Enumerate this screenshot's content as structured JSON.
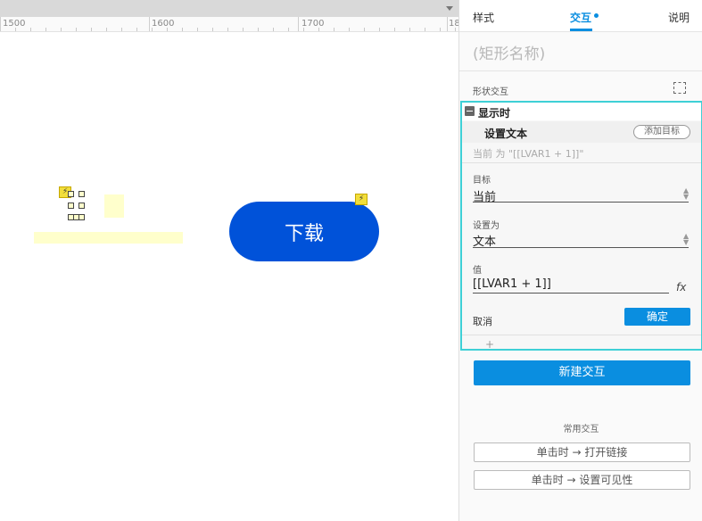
{
  "ruler": {
    "labels": [
      "1500",
      "1600",
      "1700",
      "18"
    ]
  },
  "canvas": {
    "download_label": "下载",
    "bolt_symbol": "⚡"
  },
  "panel": {
    "tabs": [
      {
        "label": "样式",
        "active": false
      },
      {
        "label": "交互",
        "active": true
      },
      {
        "label": "说明",
        "active": false
      }
    ],
    "shape_name_placeholder": "(矩形名称)",
    "section_title": "形状交互",
    "event_label": "显示时",
    "action_label": "设置文本",
    "add_target_label": "添加目标",
    "action_summary": "当前 为 \"[[LVAR1 + 1]]\"",
    "fields": {
      "target_label": "目标",
      "target_value": "当前",
      "set_as_label": "设置为",
      "set_as_value": "文本",
      "value_label": "值",
      "value_value": "[[LVAR1 + 1]]"
    },
    "fx_label": "fx",
    "cancel_label": "取消",
    "ok_label": "确定",
    "plus_label": "+",
    "new_interaction_label": "新建交互",
    "common_title": "常用交互",
    "common_buttons": [
      "单击时 → 打开链接",
      "单击时 → 设置可见性"
    ]
  },
  "colors": {
    "accent": "#0a8ee0",
    "download_button": "#0052d9",
    "highlight_border": "#3ed0d6",
    "widget_fill": "#ffffcc",
    "bolt": "#f2de3b"
  }
}
